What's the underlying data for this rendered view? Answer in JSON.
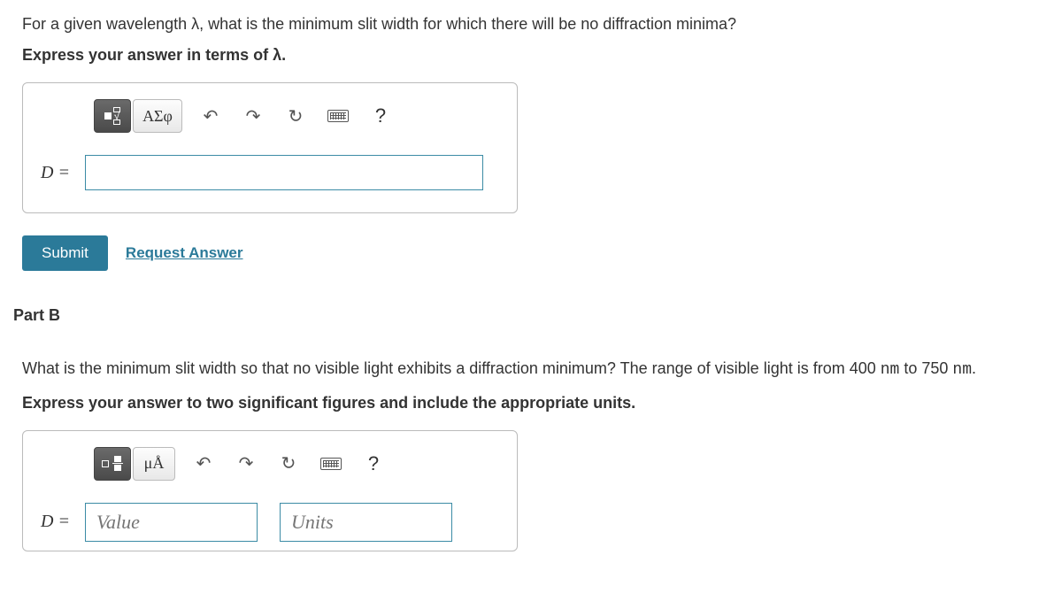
{
  "partA": {
    "question": "For a given wavelength λ, what is the minimum slit width for which there will be no diffraction minima?",
    "instruction": "Express your answer in terms of λ.",
    "variable": "D =",
    "toolbar": {
      "greek": "ΑΣφ"
    },
    "submit": "Submit",
    "request": "Request Answer"
  },
  "partB": {
    "header": "Part B",
    "question_prefix": "What is the minimum slit width so that no visible light exhibits a diffraction minimum? The range of visible light is from 400 ",
    "nm1": "nm",
    "question_mid": " to 750 ",
    "nm2": "nm",
    "question_suffix": ".",
    "instruction": "Express your answer to two significant figures and include the appropriate units.",
    "variable": "D =",
    "valuePlaceholder": "Value",
    "unitsPlaceholder": "Units",
    "toolbar": {
      "units": "μÅ"
    }
  }
}
